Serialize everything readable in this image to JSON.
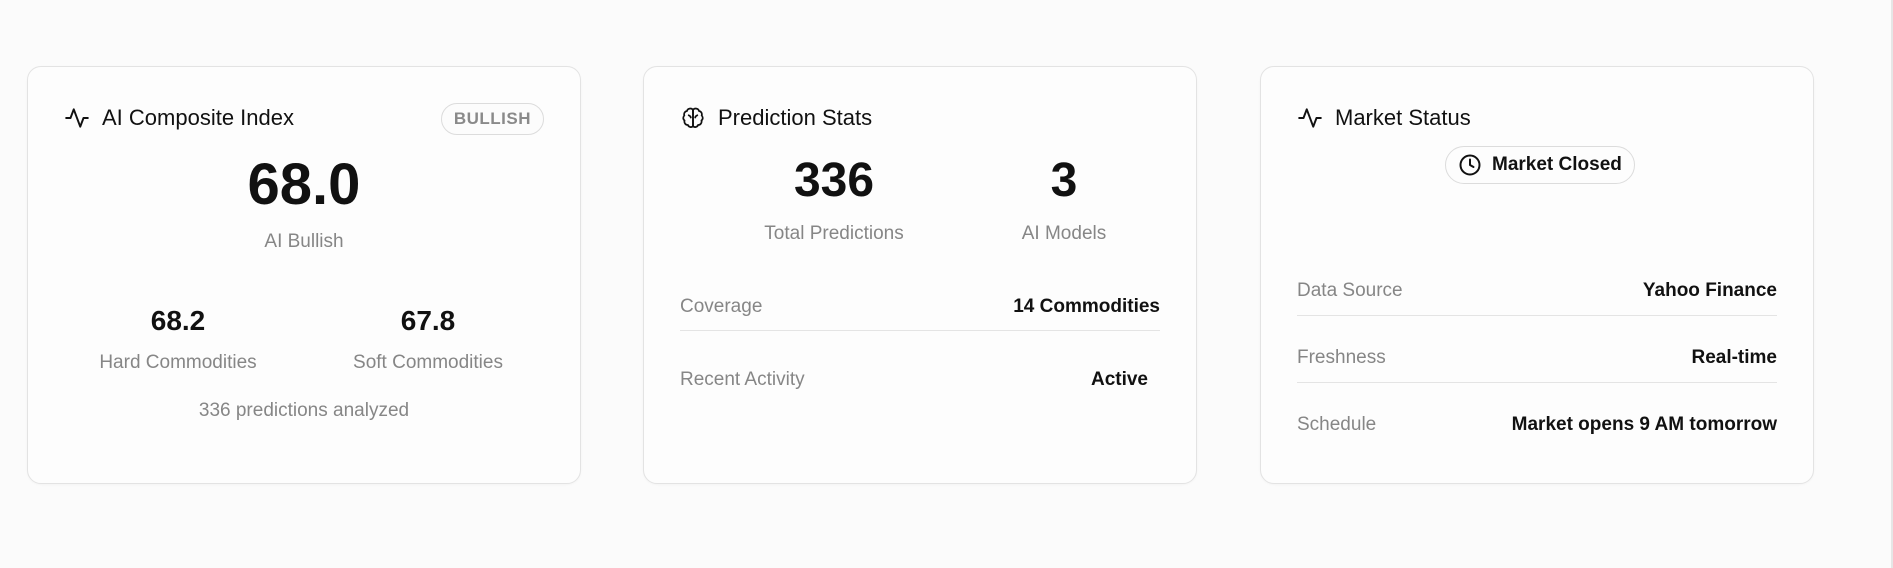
{
  "composite": {
    "title": "AI Composite Index",
    "icon": "activity-icon",
    "badge": "BULLISH",
    "value": "68.0",
    "value_label": "AI Bullish",
    "hard": {
      "value": "68.2",
      "label": "Hard Commodities"
    },
    "soft": {
      "value": "67.8",
      "label": "Soft Commodities"
    },
    "footer": "336 predictions analyzed"
  },
  "prediction": {
    "title": "Prediction Stats",
    "icon": "brain-icon",
    "total": {
      "value": "336",
      "label": "Total Predictions"
    },
    "models": {
      "value": "3",
      "label": "AI Models"
    },
    "rows": [
      {
        "key": "Coverage",
        "value": "14 Commodities"
      },
      {
        "key": "Recent Activity",
        "value": "Active"
      }
    ]
  },
  "market": {
    "title": "Market Status",
    "icon": "activity-icon",
    "status": "Market Closed",
    "status_icon": "clock-icon",
    "rows": [
      {
        "key": "Data Source",
        "value": "Yahoo Finance"
      },
      {
        "key": "Freshness",
        "value": "Real-time"
      },
      {
        "key": "Schedule",
        "value": "Market opens 9 AM tomorrow"
      }
    ]
  },
  "colors": {
    "text": "#111111",
    "muted": "#868686",
    "border": "#e3e3e3",
    "background": "#fbfbfb"
  }
}
